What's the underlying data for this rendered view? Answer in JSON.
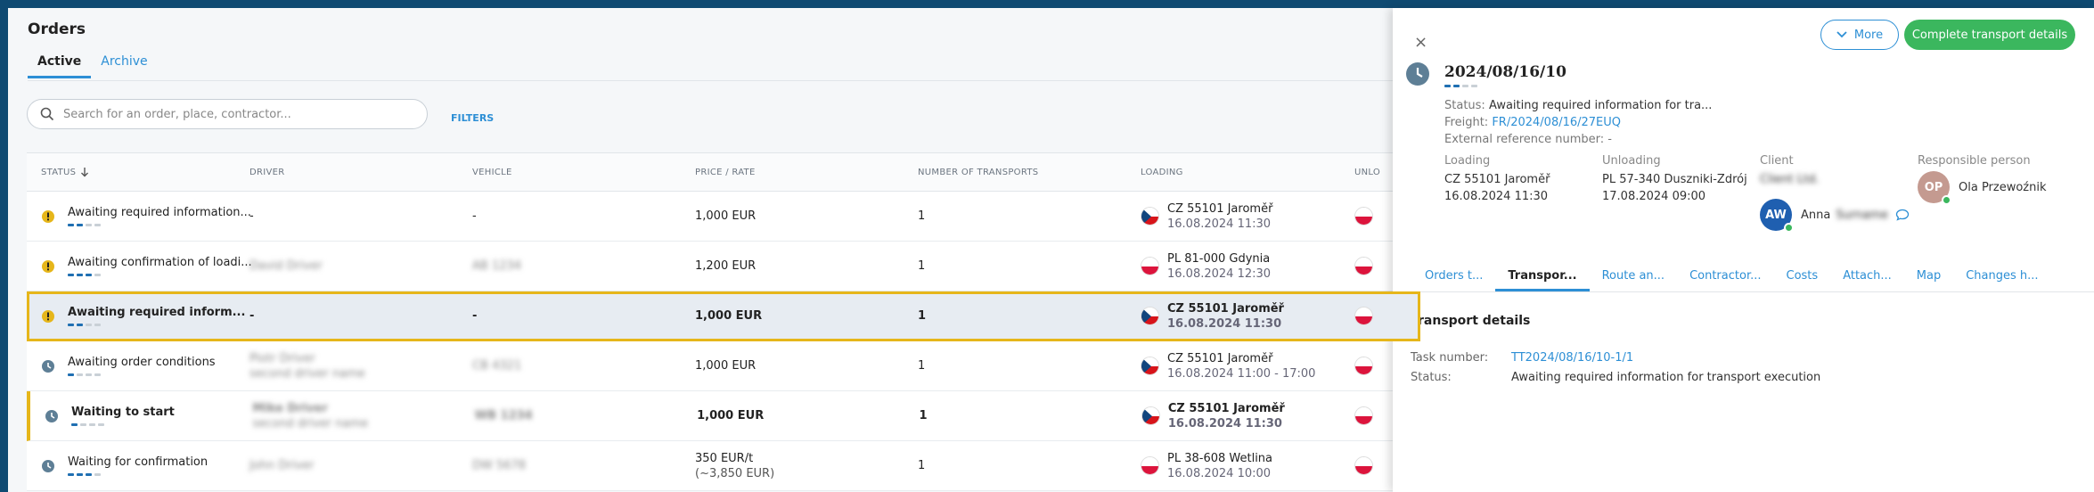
{
  "page": {
    "title": "Orders"
  },
  "tabs": [
    {
      "label": "Active",
      "active": true
    },
    {
      "label": "Archive",
      "active": false
    }
  ],
  "search": {
    "placeholder": "Search for an order, place, contractor...",
    "value": ""
  },
  "filters_label": "FILTERS",
  "table": {
    "headers": {
      "status": "STATUS",
      "driver": "DRIVER",
      "vehicle": "VEHICLE",
      "price": "PRICE / RATE",
      "transports": "NUMBER OF TRANSPORTS",
      "loading": "LOADING",
      "unloading": "UNLO"
    },
    "rows": [
      {
        "status_icon": "warning-icon",
        "status": "Awaiting required information...",
        "progress_steps": 4,
        "progress_done": 2,
        "driver": "-",
        "driver_sub": "",
        "vehicle": "-",
        "price": "1,000 EUR",
        "price_sub": "",
        "transports": "1",
        "loading_flag": "cz",
        "loading_city": "CZ 55101 Jaroměř",
        "loading_date": "16.08.2024 11:30",
        "unloading_flag": "pl",
        "selected": false,
        "highlight": false,
        "bold": false,
        "blur_driver": false,
        "blur_vehicle": false
      },
      {
        "status_icon": "warning-icon",
        "status": "Awaiting confirmation of loadi...",
        "progress_steps": 4,
        "progress_done": 3,
        "driver": "David Driver",
        "driver_sub": "",
        "vehicle": "AB 1234",
        "price": "1,200 EUR",
        "price_sub": "",
        "transports": "1",
        "loading_flag": "pl",
        "loading_city": "PL 81-000 Gdynia",
        "loading_date": "16.08.2024 12:30",
        "unloading_flag": "pl",
        "selected": false,
        "highlight": false,
        "bold": false,
        "blur_driver": true,
        "blur_vehicle": true
      },
      {
        "status_icon": "warning-icon",
        "status": "Awaiting required inform...",
        "progress_steps": 4,
        "progress_done": 2,
        "driver": "-",
        "driver_sub": "",
        "vehicle": "-",
        "price": "1,000 EUR",
        "price_sub": "",
        "transports": "1",
        "loading_flag": "cz",
        "loading_city": "CZ 55101 Jaroměř",
        "loading_date": "16.08.2024 11:30",
        "unloading_flag": "pl",
        "selected": true,
        "highlight": false,
        "bold": true,
        "blur_driver": false,
        "blur_vehicle": false
      },
      {
        "status_icon": "clock-icon",
        "status": "Awaiting order conditions",
        "progress_steps": 4,
        "progress_done": 1,
        "driver": "Piotr Driver",
        "driver_sub": "second driver name",
        "vehicle": "CB 4321",
        "price": "1,000 EUR",
        "price_sub": "",
        "transports": "1",
        "loading_flag": "cz",
        "loading_city": "CZ 55101 Jaroměř",
        "loading_date": "16.08.2024 11:00 - 17:00",
        "unloading_flag": "pl",
        "selected": false,
        "highlight": false,
        "bold": false,
        "blur_driver": true,
        "blur_vehicle": true
      },
      {
        "status_icon": "clock-icon",
        "status": "Waiting to start",
        "progress_steps": 4,
        "progress_done": 1,
        "driver": "Mike Driver",
        "driver_sub": "second driver name",
        "vehicle": "WB 1234",
        "price": "1,000 EUR",
        "price_sub": "",
        "transports": "1",
        "loading_flag": "cz",
        "loading_city": "CZ 55101 Jaroměř",
        "loading_date": "16.08.2024 11:30",
        "unloading_flag": "pl",
        "selected": false,
        "highlight": true,
        "bold": true,
        "blur_driver": true,
        "blur_vehicle": true
      },
      {
        "status_icon": "clock-icon",
        "status": "Waiting for confirmation",
        "progress_steps": 4,
        "progress_done": 3,
        "driver": "John Driver",
        "driver_sub": "",
        "vehicle": "DW 5678",
        "price": "350 EUR/t",
        "price_sub": "(~3,850 EUR)",
        "transports": "1",
        "loading_flag": "pl",
        "loading_city": "PL 38-608 Wetlina",
        "loading_date": "16.08.2024 10:00",
        "unloading_flag": "pl",
        "selected": false,
        "highlight": false,
        "bold": false,
        "blur_driver": true,
        "blur_vehicle": true
      }
    ]
  },
  "panel": {
    "close_label": "×",
    "more_label": "More",
    "complete_label": "Complete transport details",
    "order_number": "2024/08/16/10",
    "status_label": "Status:",
    "status_value": "Awaiting required information for tra...",
    "freight_label": "Freight:",
    "freight_value": "FR/2024/08/16/27EUQ",
    "ext_ref": "External reference number: -",
    "loading_label": "Loading",
    "loading_place": "CZ 55101 Jaroměř",
    "loading_date": "16.08.2024 11:30",
    "unloading_label": "Unloading",
    "unloading_place": "PL 57-340 Duszniki-Zdrój",
    "unloading_date": "17.08.2024 09:00",
    "client_label": "Client",
    "client_name": "Client Ltd.",
    "client_person_initials": "AW",
    "client_person_name": "Anna",
    "client_person_surname": "Surname",
    "responsible_label": "Responsible person",
    "responsible_initials": "OP",
    "responsible_name": "Ola Przewoźnik",
    "tabs": [
      {
        "label": "Orders t...",
        "active": false
      },
      {
        "label": "Transpor...",
        "active": true
      },
      {
        "label": "Route an...",
        "active": false
      },
      {
        "label": "Contractor...",
        "active": false
      },
      {
        "label": "Costs",
        "active": false
      },
      {
        "label": "Attach...",
        "active": false
      },
      {
        "label": "Map",
        "active": false
      },
      {
        "label": "Changes h...",
        "active": false
      }
    ],
    "section_title": "Transport details",
    "task_number_label": "Task number:",
    "task_number_value": "TT2024/08/16/10-1/1",
    "detail_status_label": "Status:",
    "detail_status_value": "Awaiting required information for transport execution"
  },
  "colors": {
    "accent": "#2d8fd5",
    "success": "#3bb75e",
    "warning": "#e6b61a",
    "frame": "#0f4a72"
  }
}
